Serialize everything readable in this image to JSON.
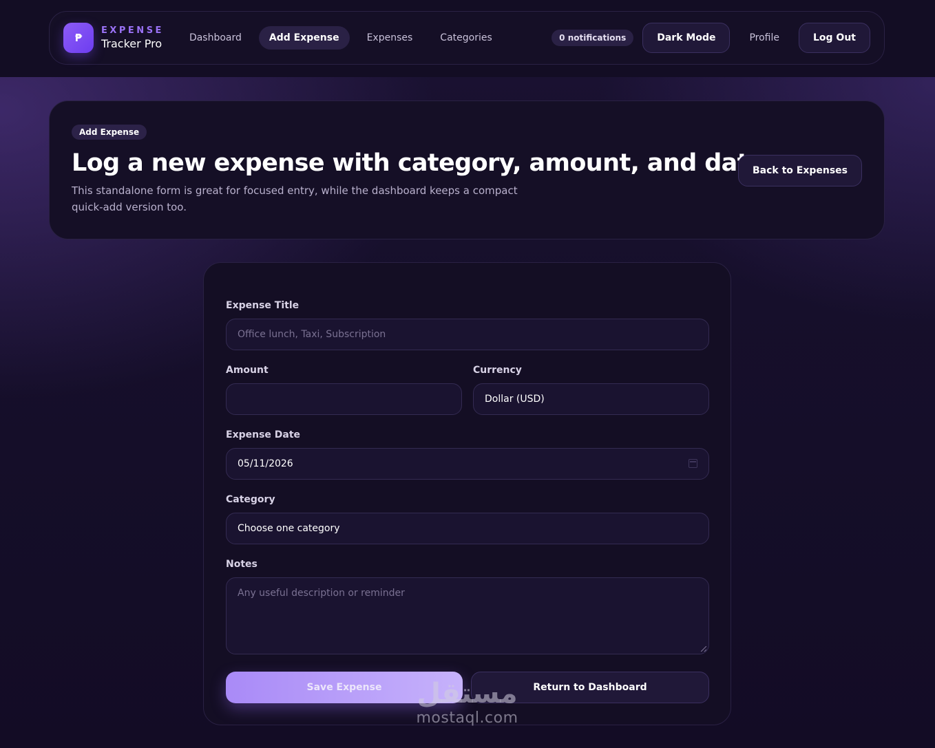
{
  "navbar": {
    "logo_symbol": "₱",
    "brand_top": "EXPENSE",
    "brand_bottom": "Tracker Pro",
    "links": [
      "Dashboard",
      "Add Expense",
      "Expenses",
      "Categories"
    ],
    "active_link": "Add Expense",
    "notifications": "0 notifications",
    "dark_mode": "Dark Mode",
    "profile": "Profile",
    "logout": "Log Out"
  },
  "hero": {
    "badge": "Add Expense",
    "title": "Log a new expense with category, amount, and date.",
    "description": "This standalone form is great for focused entry, while the dashboard keeps a compact quick-add version too.",
    "back_button": "Back to Expenses"
  },
  "form": {
    "title_label": "Expense Title",
    "title_placeholder": "Office lunch, Taxi, Subscription",
    "amount_label": "Amount",
    "amount_value": "",
    "currency_label": "Currency",
    "currency_value": "Dollar (USD)",
    "date_label": "Expense Date",
    "date_value": "05/11/2026",
    "category_label": "Category",
    "category_value": "Choose one category",
    "notes_label": "Notes",
    "notes_placeholder": "Any useful description or reminder",
    "save_button": "Save Expense",
    "return_button": "Return to Dashboard"
  },
  "watermark": {
    "arabic": "مستقل",
    "latin": "mostaql.com"
  },
  "colors": {
    "accent": "#7c4dff",
    "brand_text": "#9a72f5",
    "background": "#160f2b",
    "card": "#150f26",
    "save_button": "#b49cf9"
  },
  "icons": {
    "date_field": "calendar-icon",
    "notes_field": "resize-handle-icon"
  }
}
